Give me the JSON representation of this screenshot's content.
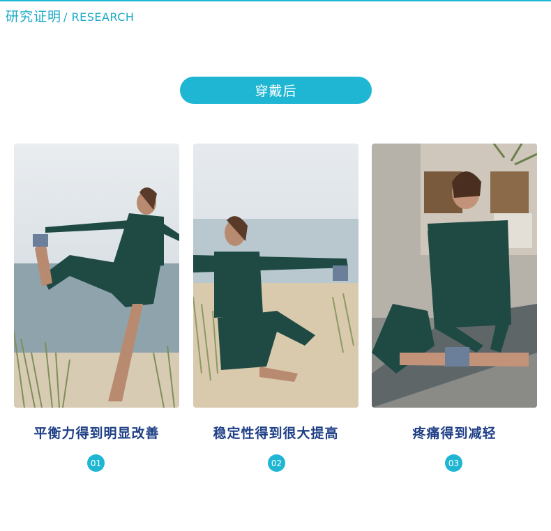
{
  "header": {
    "title_cn": "研究证明",
    "separator": "/",
    "title_en": "RESEARCH"
  },
  "banner": {
    "label": "穿戴后"
  },
  "items": [
    {
      "caption": "平衡力得到明显改善",
      "number": "01",
      "image": "woman-balance-pose-beach-photo"
    },
    {
      "caption": "稳定性得到很大提高",
      "number": "02",
      "image": "woman-stretch-on-sand-photo"
    },
    {
      "caption": "疼痛得到减轻",
      "number": "03",
      "image": "woman-yoga-mat-indoor-photo"
    }
  ],
  "colors": {
    "accent": "#1fb6d3",
    "caption_text": "#1f3f86",
    "header_text": "#1aa9c6"
  }
}
